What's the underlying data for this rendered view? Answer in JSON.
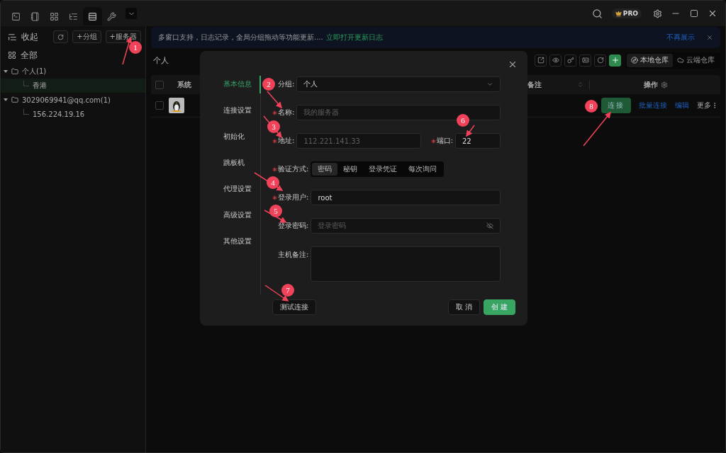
{
  "top_tabs": [
    {
      "selected": false
    },
    {
      "selected": false
    },
    {
      "selected": false
    },
    {
      "selected": false
    },
    {
      "selected": true
    },
    {
      "selected": false
    }
  ],
  "pro_badge": "PRO",
  "sidebar": {
    "collapse": "收起",
    "buttons": [
      "+分组",
      "+服务器"
    ],
    "all": "全部",
    "tree": [
      {
        "label": "个人(1)",
        "expanded": true,
        "children": [
          {
            "label": "香港",
            "selected": true
          }
        ]
      },
      {
        "label": "3029069941@qq.com(1)",
        "expanded": true,
        "children": [
          {
            "label": "156.224.19.16",
            "selected": false
          }
        ]
      }
    ]
  },
  "notice": {
    "text": "多窗口支持，日志记录，全局分组拖动等功能更新....",
    "link": "立即打开更新日志",
    "dismiss": "不再展示"
  },
  "group_title": "个人",
  "storage_tabs": [
    {
      "label": "本地仓库",
      "selected": true
    },
    {
      "label": "云端仓库",
      "selected": false
    }
  ],
  "table": {
    "columns": [
      {
        "kind": "plain",
        "label": "系统"
      },
      {
        "kind": "sortable",
        "label": "备注"
      },
      {
        "kind": "settings",
        "label": "操作"
      }
    ],
    "header_checked": false,
    "rows": [
      {
        "checked": false,
        "connect": "连接",
        "links": [
          "批量连接",
          "编辑"
        ],
        "more": "更多"
      }
    ]
  },
  "dialog": {
    "nav": [
      {
        "label": "基本信息",
        "selected": true
      },
      {
        "label": "连接设置",
        "selected": false
      },
      {
        "label": "初始化",
        "selected": false
      },
      {
        "label": "跳板机",
        "selected": false
      },
      {
        "label": "代理设置",
        "selected": false
      },
      {
        "label": "高级设置",
        "selected": false
      },
      {
        "label": "其他设置",
        "selected": false
      }
    ],
    "form": [
      {
        "kind": "select",
        "label": "分组:",
        "required": false,
        "value": "个人"
      },
      {
        "kind": "text",
        "label": "名称:",
        "required": true,
        "placeholder": "我的服务器"
      },
      {
        "kind": "pair",
        "label": "地址:",
        "required": true,
        "placeholder": "112.221.141.33",
        "second": {
          "label": "端口:",
          "required": true,
          "value": "22"
        }
      },
      {
        "kind": "segmented",
        "label": "验证方式:",
        "required": true,
        "options": [
          {
            "label": "密码",
            "selected": true
          },
          {
            "label": "秘钥",
            "selected": false
          },
          {
            "label": "登录凭证",
            "selected": false
          },
          {
            "label": "每次询问",
            "selected": false
          }
        ]
      },
      {
        "kind": "text",
        "label": "登录用户:",
        "required": true,
        "value": "root"
      },
      {
        "kind": "password",
        "label": "登录密码:",
        "required": false,
        "placeholder": "登录密码"
      },
      {
        "kind": "textarea",
        "label": "主机备注:",
        "required": false
      }
    ],
    "test_button": "测试连接",
    "cancel_button": "取 消",
    "create_button": "创 建"
  },
  "annotations": [
    "1",
    "2",
    "3",
    "4",
    "5",
    "6",
    "7",
    "8"
  ]
}
